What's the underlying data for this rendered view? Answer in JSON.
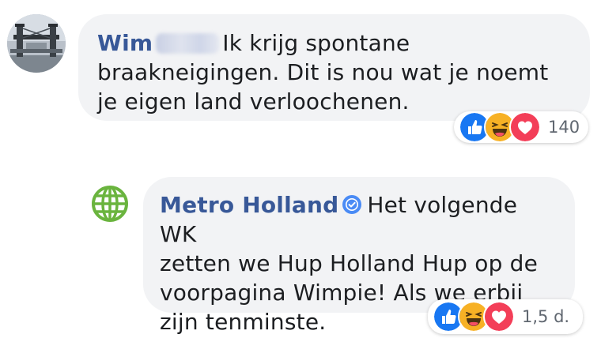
{
  "comments": [
    {
      "author": "Wim",
      "text_line1": "Ik krijg spontane",
      "text_line2": "braakneigingen. Dit is nou wat je noemt",
      "text_line3": "je eigen land verloochenen.",
      "reaction_count": "140",
      "reaction_icons": [
        "like-icon",
        "haha-icon",
        "love-icon"
      ]
    },
    {
      "author": "Metro Holland",
      "verified_icon": "verified-badge-icon",
      "text_line1": "Het volgende WK",
      "text_line2": "zetten we Hup Holland Hup op de",
      "text_line3": "voorpagina Wimpie! Als we erbij",
      "text_line4": "zijn tenminste.",
      "reaction_label": "1,5 d.",
      "reaction_icons": [
        "like-icon",
        "haha-icon",
        "love-icon"
      ]
    }
  ],
  "colors": {
    "author_blue": "#385898",
    "bubble_bg": "#f2f3f5",
    "like_blue": "#1877f2",
    "love_red": "#f33e58",
    "haha_yellow": "#f7b125",
    "globe_green": "#6ab43e"
  }
}
